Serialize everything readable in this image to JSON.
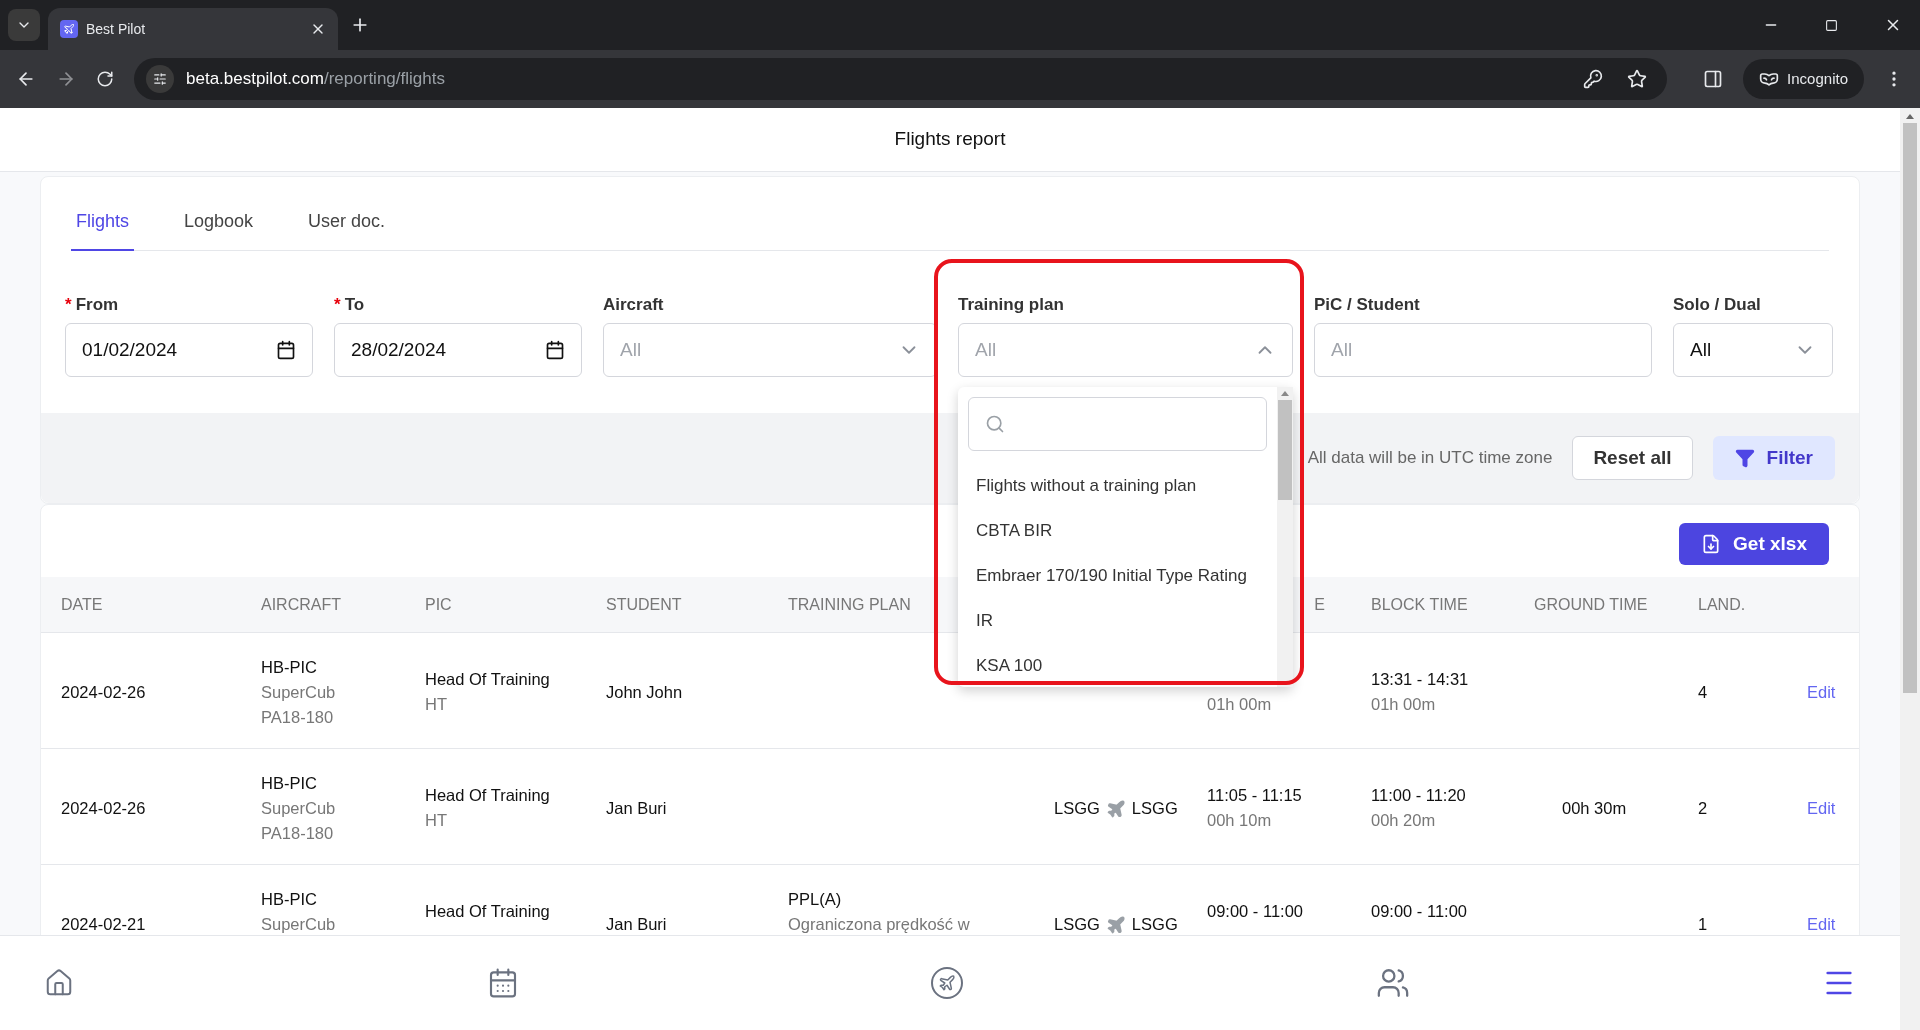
{
  "browser": {
    "tab_title": "Best Pilot",
    "url_host": "beta.bestpilot.com",
    "url_path": "/reporting/flights",
    "profile": "Incognito"
  },
  "page": {
    "title": "Flights report",
    "required_mark": "*"
  },
  "tabs": [
    {
      "label": "Flights",
      "selected": true
    },
    {
      "label": "Logbook",
      "selected": false
    },
    {
      "label": "User doc.",
      "selected": false
    }
  ],
  "filters": [
    {
      "kind": "date",
      "label": "From",
      "required": true,
      "value": "01/02/2024",
      "highlighted": false
    },
    {
      "kind": "date",
      "label": "To",
      "required": true,
      "value": "28/02/2024",
      "highlighted": false
    },
    {
      "kind": "select",
      "label": "Aircraft",
      "required": false,
      "placeholder": "All",
      "expanded": false,
      "highlighted": false
    },
    {
      "kind": "select",
      "label": "Training plan",
      "required": false,
      "placeholder": "All",
      "expanded": true,
      "highlighted": true,
      "options": [
        "Flights without a training plan",
        "CBTA BIR",
        "Embraer 170/190 Initial Type Rating",
        "IR",
        "KSA 100"
      ]
    },
    {
      "kind": "text",
      "label": "PiC / Student",
      "required": false,
      "placeholder": "All",
      "highlighted": false
    },
    {
      "kind": "select",
      "label": "Solo / Dual",
      "required": false,
      "value": "All",
      "expanded": false,
      "highlighted": false
    }
  ],
  "filter_bar": {
    "note": "All data will be in UTC time zone",
    "reset_button": "Reset all",
    "filter_button": "Filter"
  },
  "export_button": "Get xlsx",
  "table": {
    "columns": [
      {
        "label": "DATE"
      },
      {
        "label": "AIRCRAFT"
      },
      {
        "label": "PIC"
      },
      {
        "label": "STUDENT"
      },
      {
        "label": "TRAINING PLAN"
      },
      {},
      {
        "label": "E"
      },
      {
        "label": "BLOCK TIME"
      },
      {
        "label": "GROUND TIME"
      },
      {
        "label": "LAND."
      },
      {}
    ],
    "rows": [
      {
        "date": "2024-02-26",
        "aircraft": [
          "HB-PIC",
          "SuperCub",
          "PA18-180"
        ],
        "pic": [
          "Head Of Training",
          "HT"
        ],
        "student": "John John",
        "flight_time": {
          "duration": "01h 00m"
        },
        "block_time": {
          "range": "13:31 - 14:31",
          "duration": "01h 00m"
        },
        "landings": "4",
        "action": "Edit"
      },
      {
        "date": "2024-02-26",
        "aircraft": [
          "HB-PIC",
          "SuperCub",
          "PA18-180"
        ],
        "pic": [
          "Head Of Training",
          "HT"
        ],
        "student": "Jan Buri",
        "route": {
          "from": "LSGG",
          "to": "LSGG"
        },
        "flight_time": {
          "range": "11:05 - 11:15",
          "duration": "00h 10m"
        },
        "block_time": {
          "range": "11:00 - 11:20",
          "duration": "00h 20m"
        },
        "ground_time": "00h 30m",
        "landings": "2",
        "action": "Edit"
      },
      {
        "date": "2024-02-21",
        "aircraft": [
          "HB-PIC",
          "SuperCub"
        ],
        "pic": [
          "Head Of Training"
        ],
        "student": "Jan Buri",
        "training_plan": [
          "PPL(A)",
          "Ograniczona prędkość w"
        ],
        "route": {
          "from": "LSGG",
          "to": "LSGG"
        },
        "flight_time": {
          "range": "09:00 - 11:00"
        },
        "block_time": {
          "range": "09:00 - 11:00"
        },
        "landings": "1",
        "action": "Edit"
      }
    ]
  },
  "bottom_nav": [
    {
      "kind": "home",
      "selected": false
    },
    {
      "kind": "calendar",
      "selected": false
    },
    {
      "kind": "flight",
      "selected": false
    },
    {
      "kind": "people",
      "selected": false
    },
    {
      "kind": "menu",
      "selected": true
    }
  ]
}
